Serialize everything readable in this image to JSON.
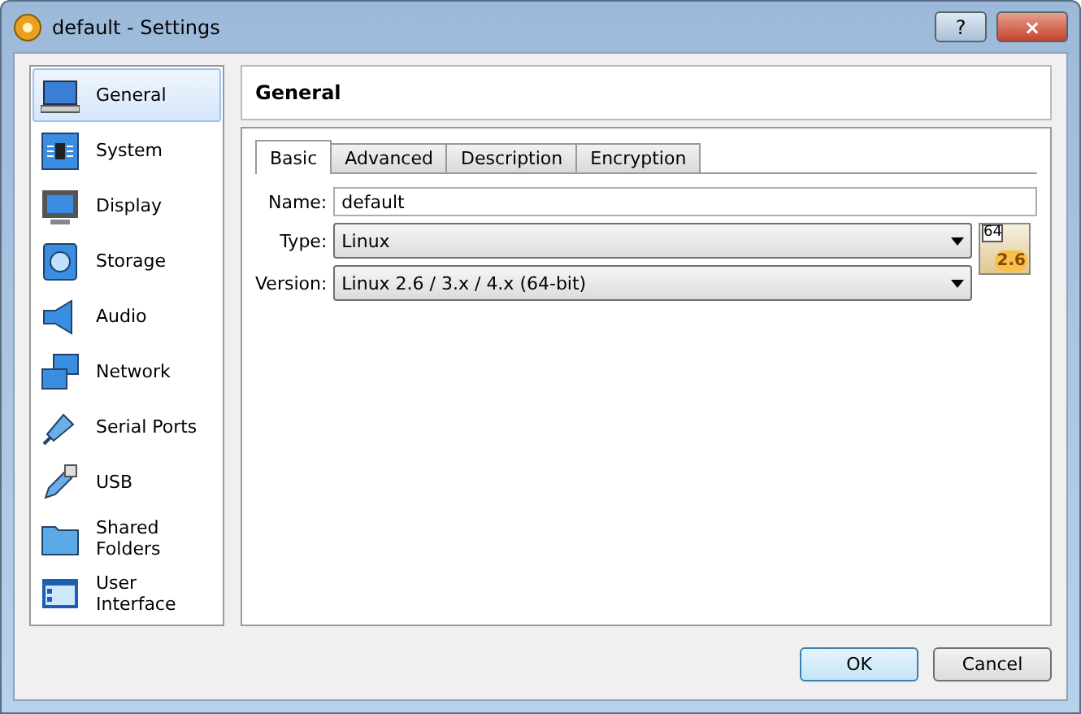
{
  "window": {
    "title": "default - Settings",
    "help_button": "?",
    "close_button": "×"
  },
  "sidebar": {
    "items": [
      {
        "label": "General",
        "selected": true
      },
      {
        "label": "System",
        "selected": false
      },
      {
        "label": "Display",
        "selected": false
      },
      {
        "label": "Storage",
        "selected": false
      },
      {
        "label": "Audio",
        "selected": false
      },
      {
        "label": "Network",
        "selected": false
      },
      {
        "label": "Serial Ports",
        "selected": false
      },
      {
        "label": "USB",
        "selected": false
      },
      {
        "label": "Shared Folders",
        "selected": false
      },
      {
        "label": "User Interface",
        "selected": false
      }
    ]
  },
  "page_title": "General",
  "tabs": [
    {
      "label": "Basic",
      "selected": true
    },
    {
      "label": "Advanced",
      "selected": false
    },
    {
      "label": "Description",
      "selected": false
    },
    {
      "label": "Encryption",
      "selected": false
    }
  ],
  "form": {
    "name": {
      "label": "Name:",
      "value": "default"
    },
    "type": {
      "label": "Type:",
      "value": "Linux"
    },
    "version": {
      "label": "Version:",
      "value": "Linux 2.6 / 3.x / 4.x (64-bit)"
    },
    "os_badge": {
      "bits": "64",
      "version": "2.6"
    }
  },
  "buttons": [
    "OK",
    "Cancel"
  ]
}
